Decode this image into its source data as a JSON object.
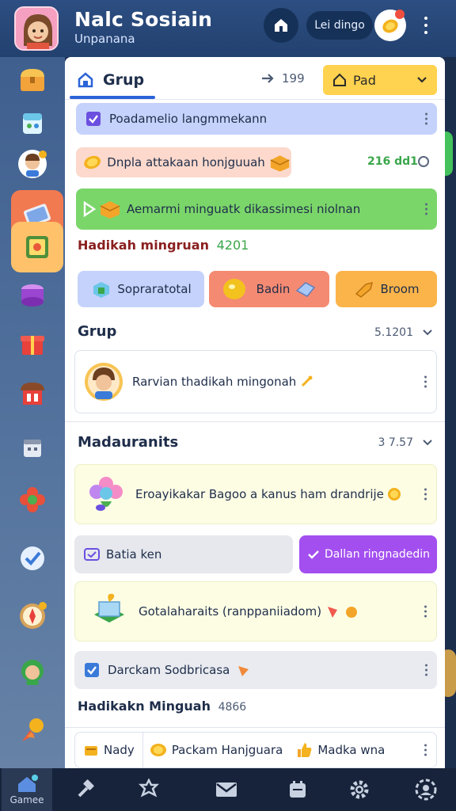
{
  "header": {
    "title": "Nalc Sosiain",
    "subtitle": "Unpanana",
    "pill_label": "Lei dingo"
  },
  "tabbar": {
    "tab_label": "Grup",
    "stat_value": "199",
    "select_value": "Pad"
  },
  "rows": {
    "top_item": "Poadamelio langmmekann",
    "coin_item": "Dnpla attakaan honjguuah",
    "coin_item_value": "216 dd1",
    "green_item": "Aemarmi minguatk dikassimesi niolnan"
  },
  "rewards": {
    "label": "Hadikah mingruan",
    "value": "4201"
  },
  "buttons": {
    "b1": "Sopraratotal",
    "b2": "Badin",
    "b3": "Broom"
  },
  "group_section": {
    "title": "Grup",
    "count": "5.1201",
    "card_text": "Rarvian thadikah mingonah"
  },
  "members_section": {
    "title": "Madauranits",
    "count": "3 7.57",
    "card1_text": "Eroayikakar Bagoo a kanus ham drandrije",
    "half_left": "Batia ken",
    "half_right": "Dallan ringnadedin",
    "card2_text": "Gotalaharaits (ranppaniiadom)",
    "card3_text": "Darckam Sodbricasa"
  },
  "footer_section": {
    "label": "Hadikakn Minguah",
    "value": "4866",
    "items": [
      "Nady",
      "Packam Hanjguara",
      "Madka wna"
    ]
  },
  "bottom_nav": {
    "home_label": "Gamee"
  },
  "colors": {
    "header_bg": "#2d4e82",
    "accent_blue": "#2b63d8",
    "select_yellow": "#ffd24f",
    "purple_button": "#a34ff0",
    "green_row": "#7bd66a"
  }
}
